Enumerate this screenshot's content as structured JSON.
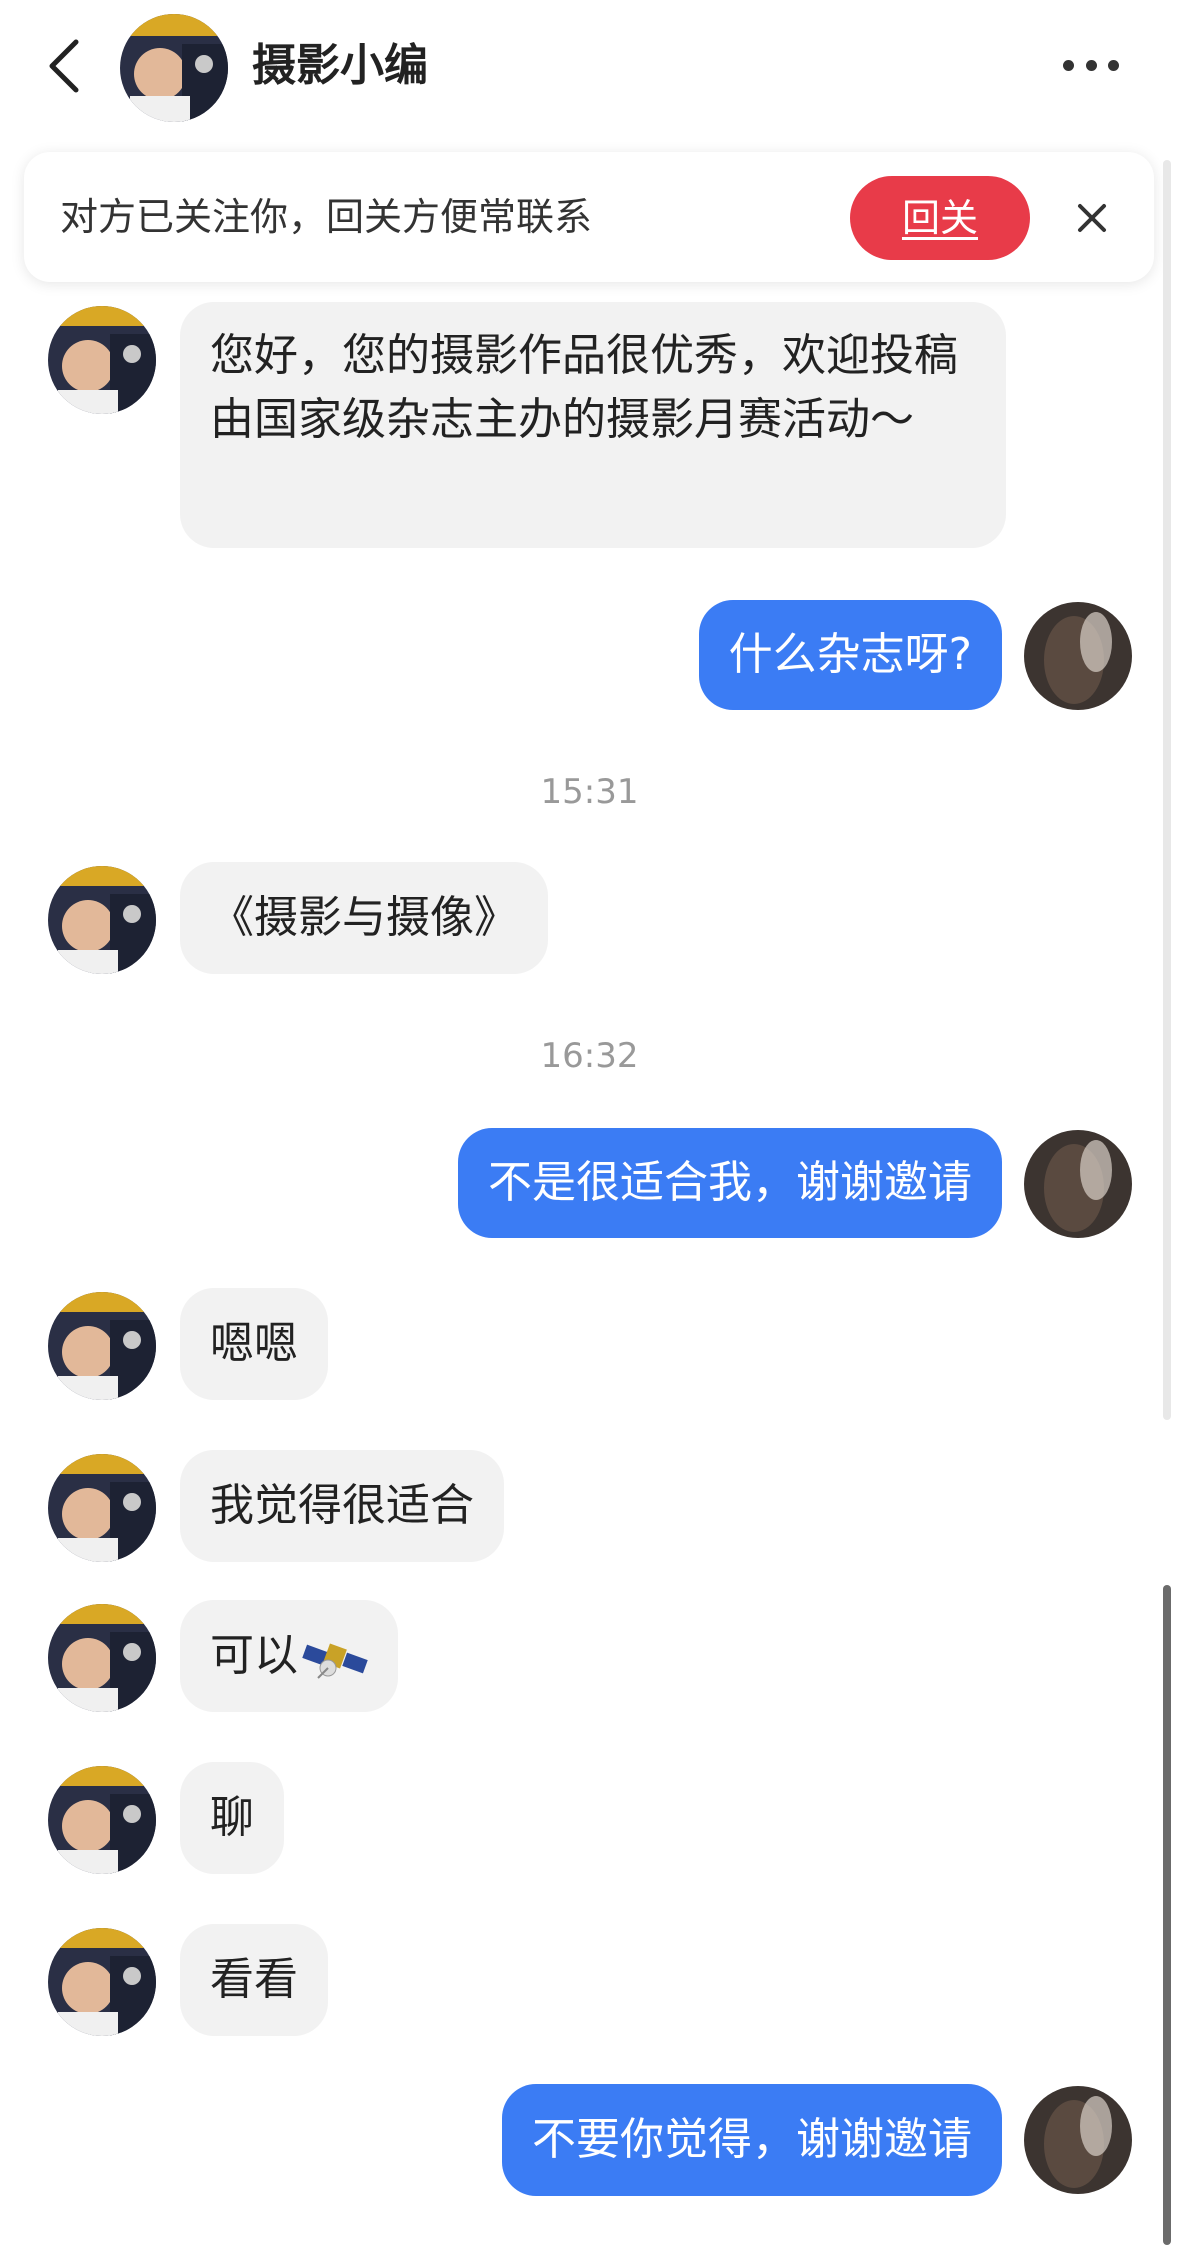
{
  "header": {
    "title": "摄影小编"
  },
  "banner": {
    "text": "对方已关注你，回关方便常联系",
    "follow_label": "回关"
  },
  "messages": [
    {
      "side": "in",
      "text": "您好，您的摄影作品很优秀，欢迎投稿由国家级杂志主办的摄影月赛活动～"
    },
    {
      "side": "out",
      "text": "什么杂志呀?"
    },
    {
      "type": "time",
      "text": "15:31"
    },
    {
      "side": "in",
      "text": "《摄影与摄像》"
    },
    {
      "type": "time",
      "text": "16:32"
    },
    {
      "side": "out",
      "text": "不是很适合我，谢谢邀请"
    },
    {
      "side": "in",
      "text": "嗯嗯"
    },
    {
      "side": "in",
      "text": "我觉得很适合"
    },
    {
      "side": "in",
      "text": "可以",
      "emoji": "satellite-icon"
    },
    {
      "side": "in",
      "text": "聊"
    },
    {
      "side": "in",
      "text": "看看"
    },
    {
      "side": "out",
      "text": "不要你觉得，谢谢邀请"
    }
  ],
  "colors": {
    "outgoing_bubble": "#3b7cf4",
    "incoming_bubble": "#f2f2f2",
    "follow_button": "#e83b49"
  }
}
